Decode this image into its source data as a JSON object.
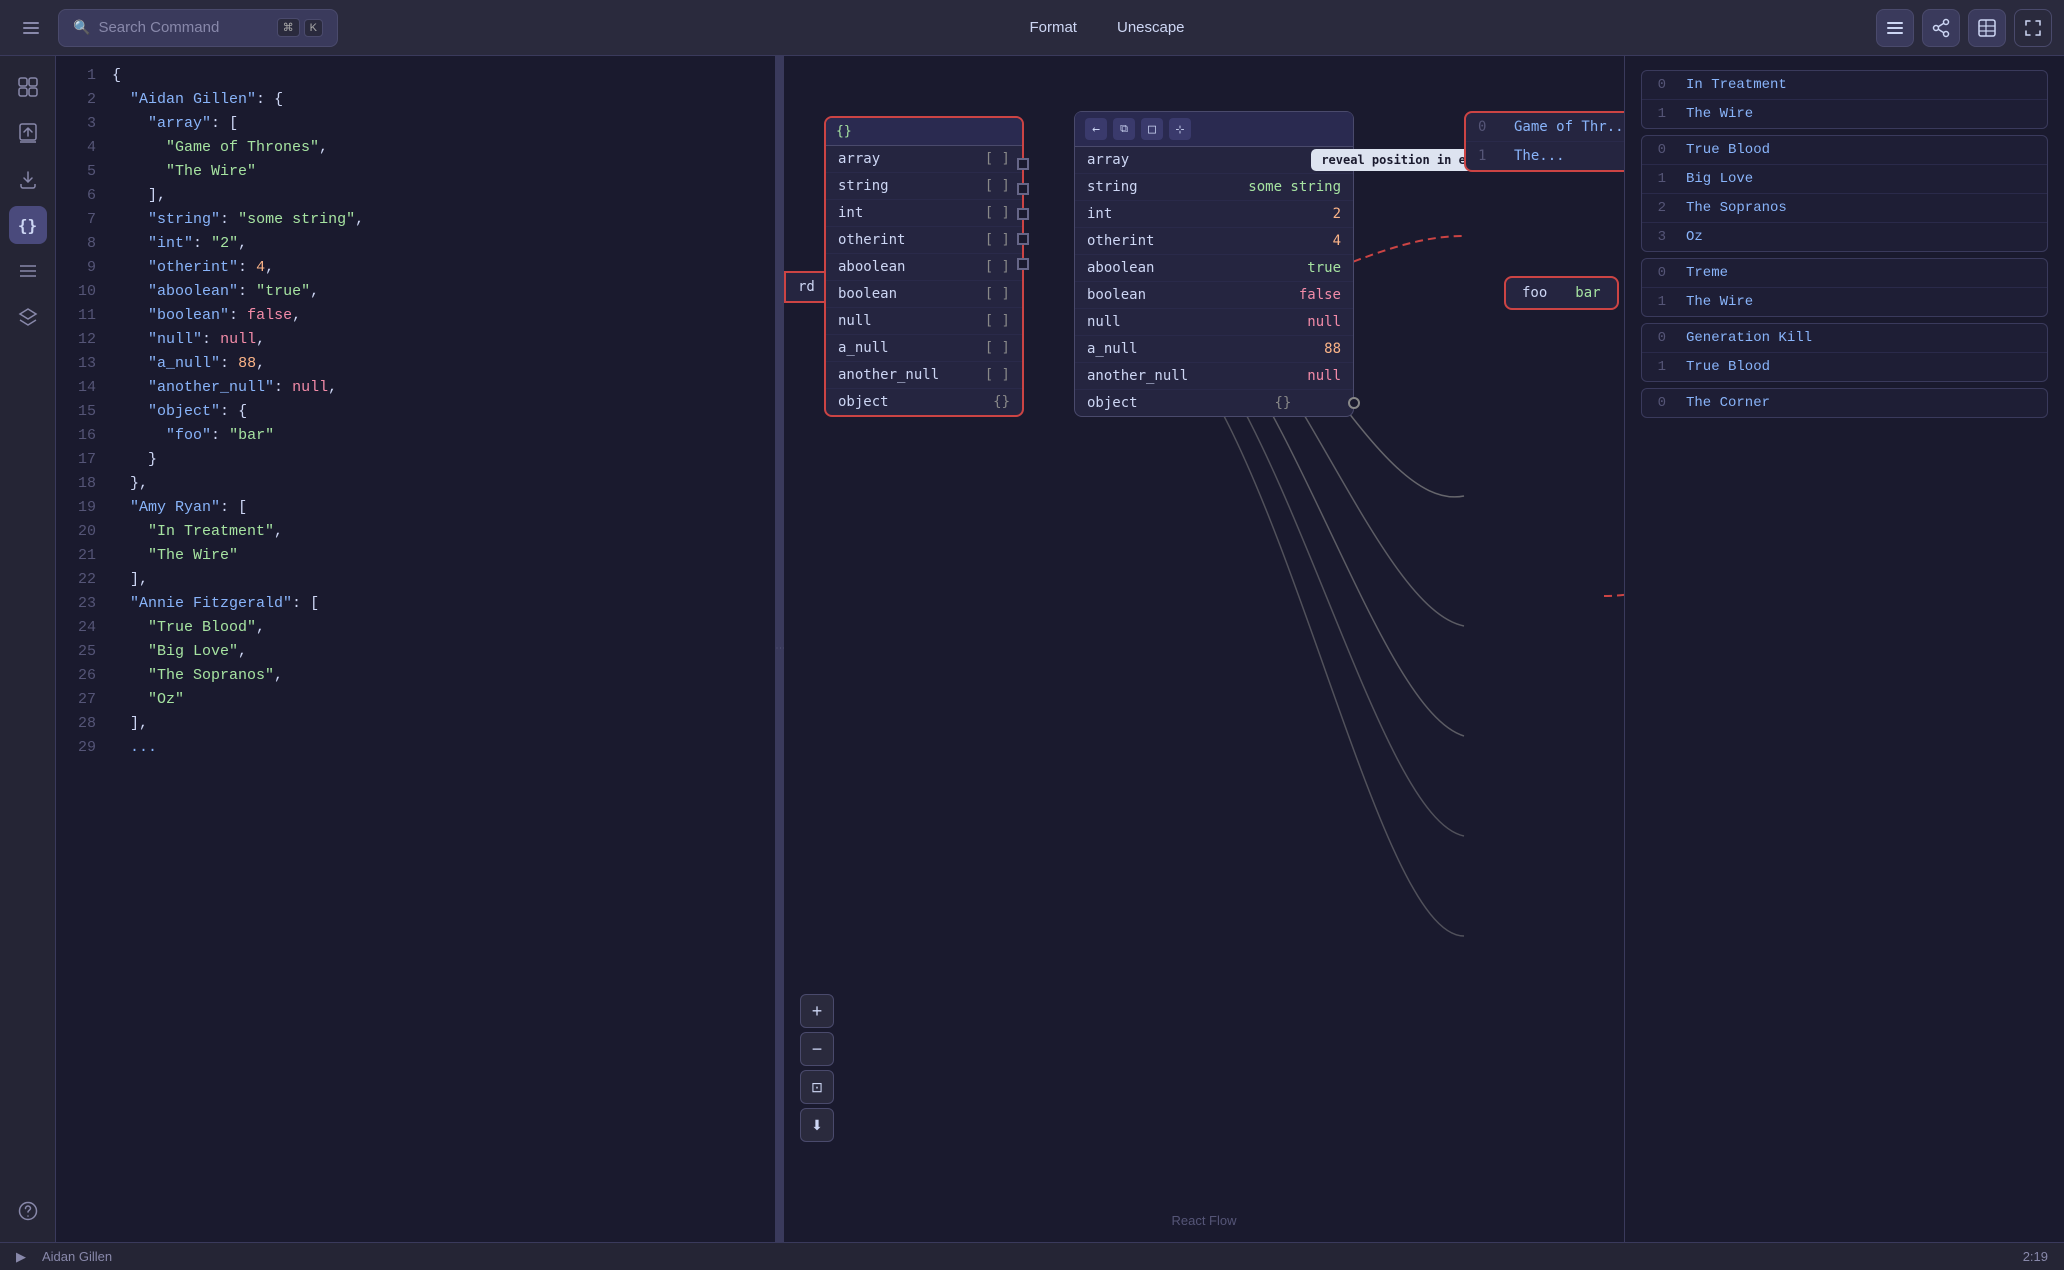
{
  "toolbar": {
    "search_placeholder": "Search Command",
    "shortcut_cmd": "⌘",
    "shortcut_key": "K",
    "format_label": "Format",
    "unescape_label": "Unescape"
  },
  "sidebar": {
    "icons": [
      {
        "name": "layout-icon",
        "symbol": "⊞",
        "active": false
      },
      {
        "name": "upload-icon",
        "symbol": "↑",
        "active": false
      },
      {
        "name": "download-icon",
        "symbol": "↓",
        "active": false
      },
      {
        "name": "braces-icon",
        "symbol": "{}",
        "active": true
      },
      {
        "name": "list-icon",
        "symbol": "≡",
        "active": false
      },
      {
        "name": "layers-icon",
        "symbol": "⧉",
        "active": false
      },
      {
        "name": "help-icon",
        "symbol": "?",
        "active": false
      }
    ]
  },
  "code": {
    "lines": [
      {
        "num": 1,
        "content": "{"
      },
      {
        "num": 2,
        "content": "  \"Aidan Gillen\": {"
      },
      {
        "num": 3,
        "content": "    \"array\": ["
      },
      {
        "num": 4,
        "content": "      \"Game of Thrones\","
      },
      {
        "num": 5,
        "content": "      \"The Wire\""
      },
      {
        "num": 6,
        "content": "    ],"
      },
      {
        "num": 7,
        "content": "    \"string\": \"some string\","
      },
      {
        "num": 8,
        "content": "    \"int\": \"2\","
      },
      {
        "num": 9,
        "content": "    \"otherint\": 4,"
      },
      {
        "num": 10,
        "content": "    \"aboolean\": \"true\","
      },
      {
        "num": 11,
        "content": "    \"boolean\": false,"
      },
      {
        "num": 12,
        "content": "    \"null\": null,"
      },
      {
        "num": 13,
        "content": "    \"a_null\": 88,"
      },
      {
        "num": 14,
        "content": "    \"another_null\": null,"
      },
      {
        "num": 15,
        "content": "    \"object\": {"
      },
      {
        "num": 16,
        "content": "      \"foo\": \"bar\""
      },
      {
        "num": 17,
        "content": "    }"
      },
      {
        "num": 18,
        "content": "  },"
      },
      {
        "num": 19,
        "content": "  \"Amy Ryan\": ["
      },
      {
        "num": 20,
        "content": "    \"In Treatment\","
      },
      {
        "num": 21,
        "content": "    \"The Wire\""
      },
      {
        "num": 22,
        "content": "  ],"
      },
      {
        "num": 23,
        "content": "  \"Annie Fitzgerald\": ["
      },
      {
        "num": 24,
        "content": "    \"True Blood\","
      },
      {
        "num": 25,
        "content": "    \"Big Love\","
      },
      {
        "num": 26,
        "content": "    \"The Sopranos\","
      },
      {
        "num": 27,
        "content": "    \"Oz\""
      },
      {
        "num": 28,
        "content": "  ],"
      },
      {
        "num": 29,
        "content": "  ..."
      }
    ]
  },
  "main_node": {
    "title": "{}",
    "rows": [
      {
        "key": "array",
        "type": "[]",
        "value": ""
      },
      {
        "key": "string",
        "type": "[]",
        "value": ""
      },
      {
        "key": "int",
        "type": "[]",
        "value": ""
      },
      {
        "key": "otherint",
        "type": "[]",
        "value": ""
      },
      {
        "key": "aboolean",
        "type": "[]",
        "value": ""
      },
      {
        "key": "boolean",
        "type": "[]",
        "value": ""
      },
      {
        "key": "null",
        "type": "[]",
        "value": ""
      },
      {
        "key": "a_null",
        "type": "[]",
        "value": ""
      },
      {
        "key": "another_null",
        "type": "[]",
        "value": ""
      },
      {
        "key": "object",
        "type": "{}",
        "value": ""
      }
    ]
  },
  "detail_node": {
    "rows": [
      {
        "key": "array",
        "value": ""
      },
      {
        "key": "string",
        "value": "some string"
      },
      {
        "key": "int",
        "value": "2"
      },
      {
        "key": "otherint",
        "value": "4"
      },
      {
        "key": "aboolean",
        "value": "true"
      },
      {
        "key": "boolean",
        "value": "false"
      },
      {
        "key": "null",
        "value": "null"
      },
      {
        "key": "a_null",
        "value": "88"
      },
      {
        "key": "another_null",
        "value": "null"
      },
      {
        "key": "object",
        "value": "{}"
      }
    ]
  },
  "tooltip": {
    "text": "reveal position in editor"
  },
  "array_top_node": {
    "items": [
      {
        "idx": "0",
        "val": "Game of Thr..."
      },
      {
        "idx": "1",
        "val": "The..."
      }
    ]
  },
  "foo_bar_node": {
    "key": "foo",
    "val": "bar"
  },
  "right_panel_nodes": [
    {
      "id": "amy_ryan",
      "items": [
        {
          "idx": "0",
          "val": "In Treatment"
        },
        {
          "idx": "1",
          "val": "The Wire"
        }
      ]
    },
    {
      "id": "annie_fitzgerald",
      "items": [
        {
          "idx": "0",
          "val": "True Blood"
        },
        {
          "idx": "1",
          "val": "Big Love"
        },
        {
          "idx": "2",
          "val": "The Sopranos"
        },
        {
          "idx": "3",
          "val": "Oz"
        }
      ]
    },
    {
      "id": "treme_thewire",
      "items": [
        {
          "idx": "0",
          "val": "Treme"
        },
        {
          "idx": "1",
          "val": "The Wire"
        }
      ]
    },
    {
      "id": "generation_kill",
      "items": [
        {
          "idx": "0",
          "val": "Generation Kill"
        },
        {
          "idx": "1",
          "val": "True Blood"
        }
      ]
    },
    {
      "id": "the_corner",
      "items": [
        {
          "idx": "0",
          "val": "The Corner"
        }
      ]
    }
  ],
  "status_bar": {
    "name": "Aidan Gillen",
    "position": "2:19"
  },
  "react_flow_label": "React Flow",
  "zoom_controls": {
    "plus": "+",
    "minus": "−",
    "fit": "⊡",
    "download": "⬇"
  }
}
